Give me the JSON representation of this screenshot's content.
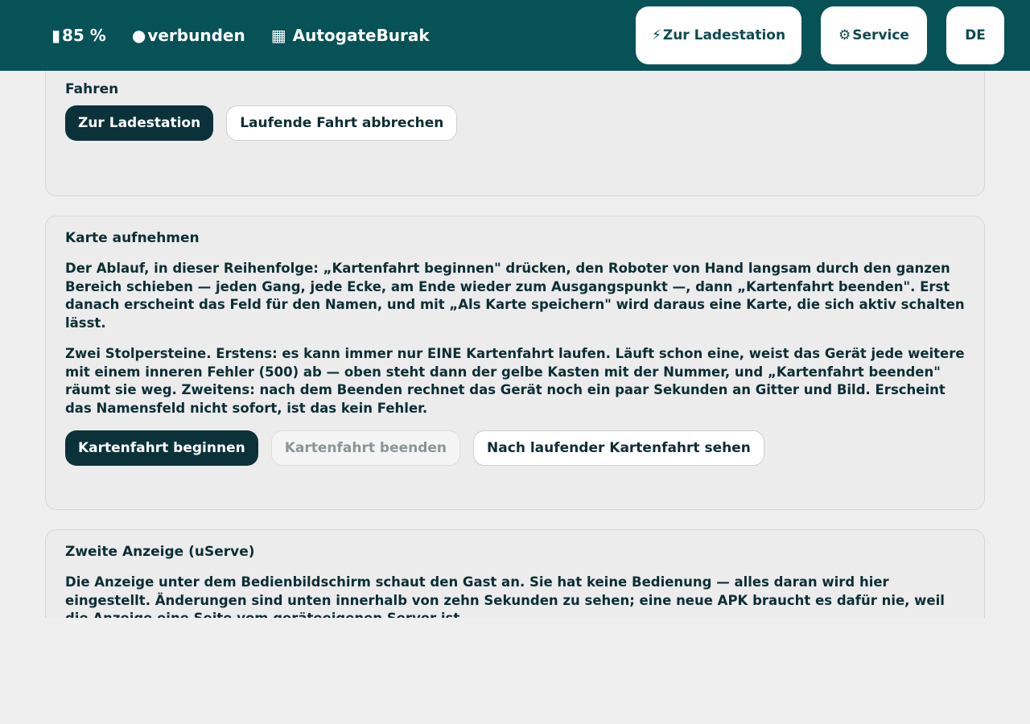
{
  "header": {
    "battery": {
      "icon": "battery-icon",
      "glyph": "▮",
      "value": "85 %"
    },
    "connection": {
      "icon": "connected-dot-icon",
      "glyph": "●",
      "label": "verbunden"
    },
    "map": {
      "icon": "map-grid-icon",
      "glyph": "▦",
      "label": "AutogateBurak"
    },
    "buttons": {
      "charge": {
        "icon": "lightning-icon",
        "glyph": "⚡",
        "label": "Zur Ladestation"
      },
      "service": {
        "icon": "gear-icon",
        "glyph": "⚙",
        "label": "Service"
      },
      "language": {
        "label": "DE"
      }
    },
    "colors": {
      "bar": "#075257",
      "button_bg": "#ffffff"
    }
  },
  "sections": {
    "drive": {
      "title": "Fahren",
      "buttons": {
        "charge": "Zur Ladestation",
        "abort": "Laufende Fahrt abbrechen"
      }
    },
    "mapping": {
      "title": "Karte aufnehmen",
      "paragraphs": [
        "Der Ablauf, in dieser Reihenfolge: „Kartenfahrt beginnen\" drücken, den Roboter von Hand langsam durch den ganzen Bereich schieben — jeden Gang, jede Ecke, am Ende wieder zum Ausgangspunkt —, dann „Kartenfahrt beenden\". Erst danach erscheint das Feld für den Namen, und mit „Als Karte speichern\" wird daraus eine Karte, die sich aktiv schalten lässt.",
        "Zwei Stolpersteine. Erstens: es kann immer nur EINE Kartenfahrt laufen. Läuft schon eine, weist das Gerät jede weitere mit einem inneren Fehler (500) ab — oben steht dann der gelbe Kasten mit der Nummer, und „Kartenfahrt beenden\" räumt sie weg. Zweitens: nach dem Beenden rechnet das Gerät noch ein paar Sekunden an Gitter und Bild. Erscheint das Namensfeld nicht sofort, ist das kein Fehler."
      ],
      "buttons": {
        "start": "Kartenfahrt beginnen",
        "stop": "Kartenfahrt beenden",
        "check": "Nach laufender Kartenfahrt sehen"
      }
    },
    "second_display": {
      "title": "Zweite Anzeige (uServe)",
      "paragraphs": [
        "Die Anzeige unter dem Bedienbildschirm schaut den Gast an. Sie hat keine Bedienung — alles daran wird hier eingestellt. Änderungen sind unten innerhalb von zehn Sekunden zu sehen; eine neue APK braucht es dafür nie, weil die Anzeige eine Seite vom geräteeigenen Server ist."
      ]
    }
  }
}
